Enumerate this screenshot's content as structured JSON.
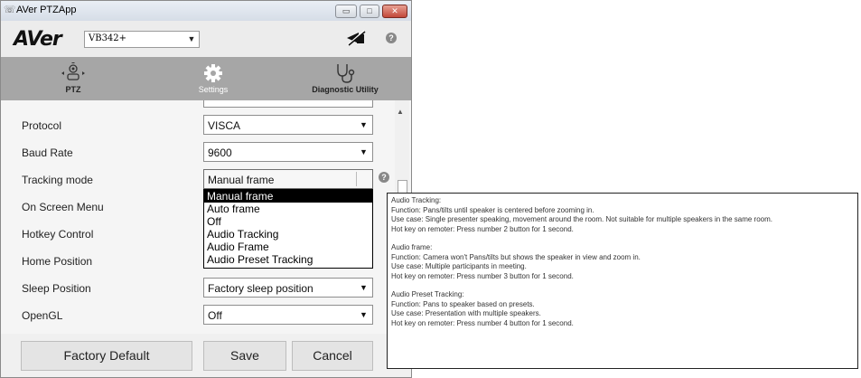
{
  "window": {
    "title": "AVer PTZApp",
    "min_glyph": "▭",
    "max_glyph": "□",
    "close_glyph": "✕"
  },
  "header": {
    "logo": "AVer",
    "model_value": "VB342+",
    "help_glyph": "?"
  },
  "nav": {
    "ptz_label": "PTZ",
    "settings_label": "Settings",
    "diagnostic_label": "Diagnostic Utility"
  },
  "settings": [
    {
      "label": "Protocol",
      "value": "VISCA"
    },
    {
      "label": "Baud Rate",
      "value": "9600"
    },
    {
      "label": "Tracking mode",
      "value": "Manual frame"
    },
    {
      "label": "On Screen Menu",
      "value": ""
    },
    {
      "label": "Hotkey Control",
      "value": ""
    },
    {
      "label": "Home Position",
      "value": ""
    },
    {
      "label": "Sleep Position",
      "value": "Factory sleep position"
    },
    {
      "label": "OpenGL",
      "value": "Off"
    }
  ],
  "tracking_options": [
    "Manual frame",
    "Auto frame",
    "Off",
    "Audio Tracking",
    "Audio Frame",
    "Audio Preset Tracking"
  ],
  "footer": {
    "factory_default": "Factory Default",
    "save": "Save",
    "cancel": "Cancel"
  },
  "tooltip": [
    {
      "title": "Audio Tracking:",
      "lines": [
        "Function: Pans/tilts until speaker is centered before zooming in.",
        "Use case: Single presenter speaking, movement around the room. Not suitable for multiple speakers in the same room.",
        "Hot key on remoter: Press number 2 button for 1 second."
      ]
    },
    {
      "title": "Audio frame:",
      "lines": [
        "Function: Camera won't Pans/tilts but shows the speaker in view and zoom in.",
        "Use case: Multiple participants in meeting.",
        "Hot key on remoter: Press number 3 button for 1 second."
      ]
    },
    {
      "title": "Audio Preset Tracking:",
      "lines": [
        "Function: Pans to speaker based on presets.",
        "Use case: Presentation with multiple speakers.",
        "Hot key on remoter: Press number 4 button for 1 second."
      ]
    }
  ]
}
